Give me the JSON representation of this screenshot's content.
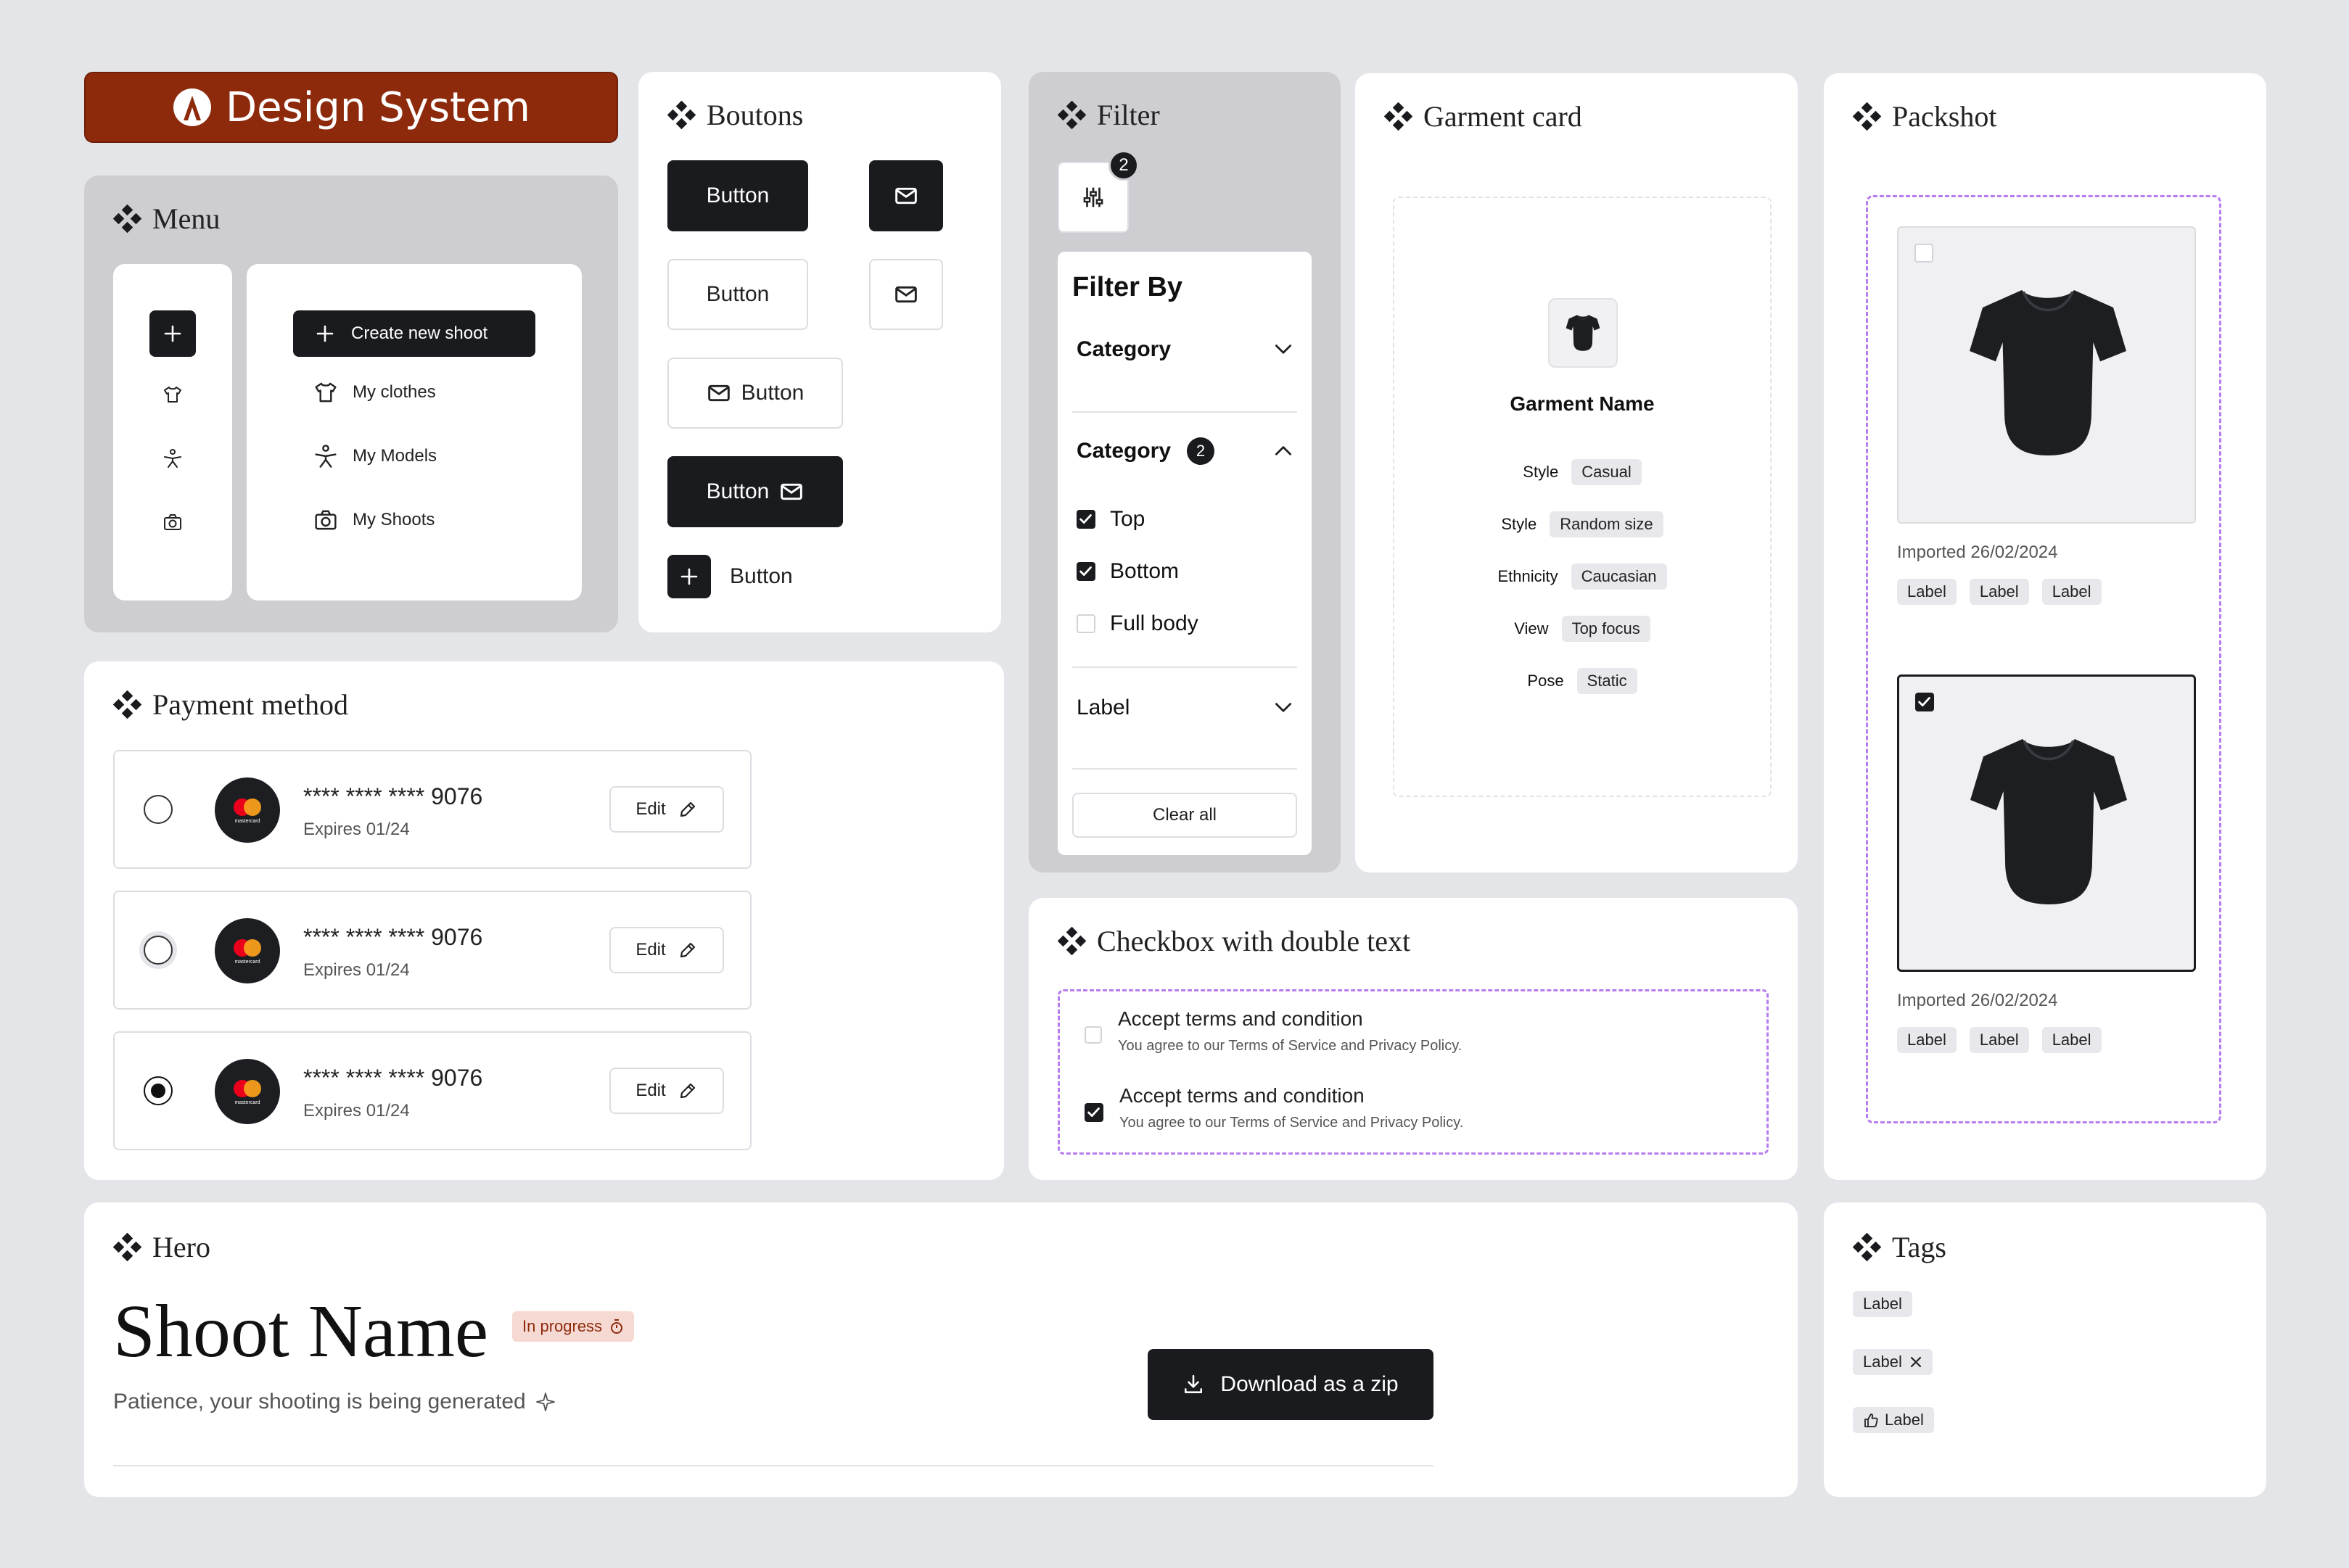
{
  "colors": {
    "background": "#e4e5e9",
    "brand": "#8e2a0c",
    "dark": "#1a1b1f",
    "accent_dashed": "#b77cf0",
    "status_bg": "#f6d9d2",
    "status_text": "#8e2a0c"
  },
  "brand": {
    "title": "Design System",
    "logo_icon": "brand-logo-icon"
  },
  "menu": {
    "title": "Menu",
    "create_label": "Create new shoot",
    "items": [
      {
        "label": "My clothes",
        "icon": "shirt-icon"
      },
      {
        "label": "My Models",
        "icon": "person-icon"
      },
      {
        "label": "My Shoots",
        "icon": "camera-icon"
      }
    ]
  },
  "buttons": {
    "title": "Boutons",
    "primary_label": "Button",
    "secondary_label": "Button",
    "icon_left_label": "Button",
    "icon_right_label": "Button",
    "add_label": "Button"
  },
  "filter": {
    "title": "Filter",
    "badge_count": "2",
    "panel_title": "Filter By",
    "section1_label": "Category",
    "section2_label": "Category",
    "section2_count": "2",
    "options": [
      {
        "label": "Top",
        "checked": true
      },
      {
        "label": "Bottom",
        "checked": true
      },
      {
        "label": "Full body",
        "checked": false
      }
    ],
    "section3_label": "Label",
    "clear_label": "Clear all"
  },
  "garment": {
    "title": "Garment card",
    "name": "Garment Name",
    "attributes": [
      {
        "key": "Style",
        "value": "Casual"
      },
      {
        "key": "Style",
        "value": "Random size"
      },
      {
        "key": "Ethnicity",
        "value": "Caucasian"
      },
      {
        "key": "View",
        "value": "Top focus"
      },
      {
        "key": "Pose",
        "value": "Static"
      }
    ]
  },
  "packshot": {
    "title": "Packshot",
    "cards": [
      {
        "date": "Imported 26/02/2024",
        "selected": false,
        "labels": [
          "Label",
          "Label",
          "Label"
        ]
      },
      {
        "date": "Imported 26/02/2024",
        "selected": true,
        "labels": [
          "Label",
          "Label",
          "Label"
        ]
      }
    ]
  },
  "payment": {
    "title": "Payment method",
    "cards": [
      {
        "number": "**** **** **** 9076",
        "expires": "Expires 01/24",
        "edit_label": "Edit",
        "state": "unselected"
      },
      {
        "number": "**** **** **** 9076",
        "expires": "Expires 01/24",
        "edit_label": "Edit",
        "state": "hover"
      },
      {
        "number": "**** **** **** 9076",
        "expires": "Expires 01/24",
        "edit_label": "Edit",
        "state": "selected"
      }
    ],
    "card_brand_text": "mastercard"
  },
  "checkbox_double": {
    "title": "Checkbox with double text",
    "items": [
      {
        "label": "Accept terms and condition",
        "sub": "You agree to our Terms of Service and Privacy Policy.",
        "checked": false
      },
      {
        "label": "Accept terms and condition",
        "sub": "You agree to our Terms of Service and Privacy Policy.",
        "checked": true
      }
    ]
  },
  "hero": {
    "title": "Hero",
    "shoot_name": "Shoot Name",
    "status": "In progress",
    "subtitle": "Patience, your shooting is being generated",
    "download_label": "Download as a zip"
  },
  "tags": {
    "title": "Tags",
    "items": [
      "Label",
      "Label",
      "Label"
    ]
  }
}
